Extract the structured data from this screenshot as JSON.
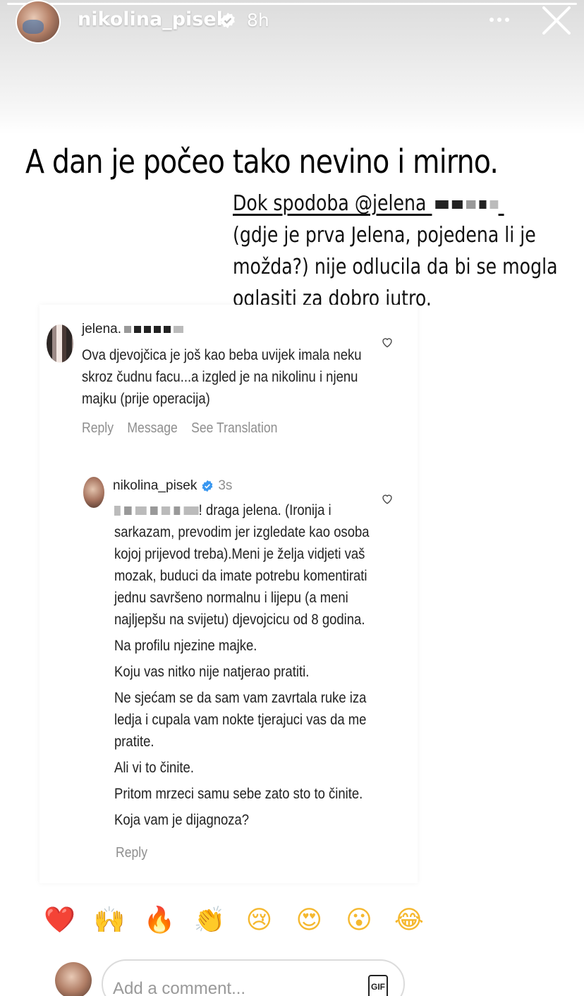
{
  "story_header": {
    "username": "nikolina_pisek",
    "time_ago": "8h",
    "verified": true,
    "more_icon": "more-horizontal-icon",
    "close_icon": "close-icon"
  },
  "story_text": {
    "headline": "A dan je počeo tako nevino i mirno.",
    "caption_lines": [
      "Dok spodoba @jelena",
      "(gdje je prva Jelena, pojedena li je",
      "možda?) nije odlucila da bi se mogla",
      "oglasiti za dobro jutro."
    ]
  },
  "screenshot": {
    "first_comment": {
      "username": "jelena.",
      "lines": [
        "Ova djevojčica je još kao beba uvijek imala neku",
        "skroz čudnu facu...a izgled je na nikolinu i njenu",
        "majku (prije operacija)"
      ],
      "actions": [
        "Reply",
        "Message",
        "See Translation"
      ]
    },
    "reply": {
      "username": "nikolina_pisek",
      "time_ago": "3s",
      "first_line_tail": "! draga jelena. (Ironija i",
      "paragraph1": [
        "sarkazam, prevodim jer izgledate kao osoba",
        "kojoj prijevod treba).Meni je želja vidjeti vaš",
        "mozak, buduci da imate potrebu komentirati",
        "jednu savršeno normalnu i lijepu (a meni",
        "najljepšu na svijetu) djevojcicu od 8 godina."
      ],
      "paragraph2": "Na profilu njezine majke.",
      "paragraph3": "Koju vas nitko nije natjerao pratiti.",
      "paragraph4": [
        "Ne sjećam se da sam vam zavrtala ruke iza",
        "ledja i cupala vam nokte tjerajuci vas da me",
        "pratite."
      ],
      "paragraph5": "Ali vi to činite.",
      "paragraph6": "Pritom mrzeci samu sebe zato sto to činite.",
      "paragraph7": "Koja vam je dijagnoza?",
      "action": "Reply"
    }
  },
  "reactions": [
    "❤️",
    "🙌",
    "🔥",
    "👏",
    "😢",
    "😍",
    "😮",
    "😂"
  ],
  "reaction_names": [
    "heart-icon",
    "raised-hands-icon",
    "fire-icon",
    "clap-icon",
    "crying-face-icon",
    "heart-eyes-icon",
    "surprised-face-icon",
    "laughing-icon"
  ],
  "composer": {
    "placeholder": "Add a comment...",
    "gif_label": "GIF"
  },
  "colors": {
    "verified": "#3897f0",
    "muted": "#8e8e8e"
  }
}
